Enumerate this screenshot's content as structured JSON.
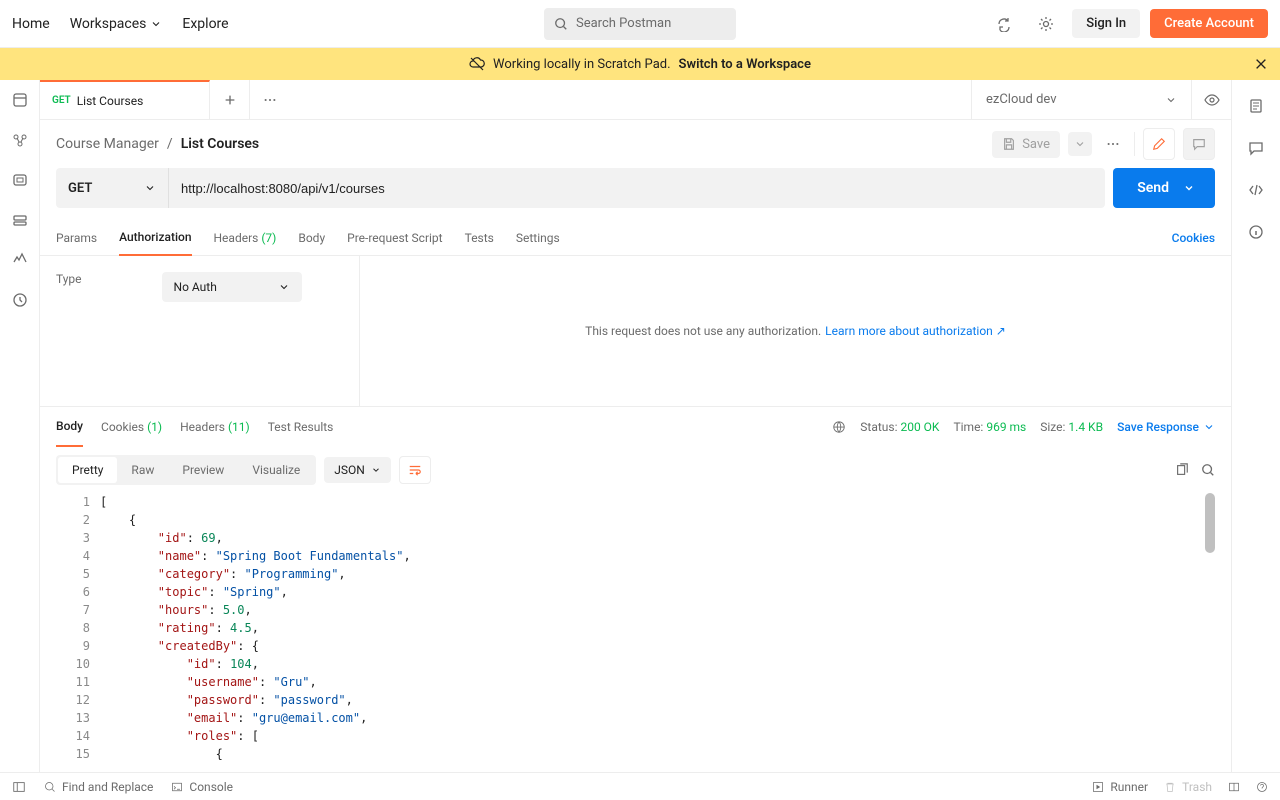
{
  "topnav": {
    "home": "Home",
    "workspaces": "Workspaces",
    "explore": "Explore",
    "search_placeholder": "Search Postman",
    "sign_in": "Sign In",
    "create_account": "Create Account"
  },
  "banner": {
    "text": "Working locally in Scratch Pad.",
    "link": "Switch to a Workspace"
  },
  "tab": {
    "method": "GET",
    "title": "List Courses"
  },
  "environment": "ezCloud dev",
  "breadcrumb": {
    "collection": "Course Manager",
    "request": "List Courses",
    "sep": "/"
  },
  "actions": {
    "save": "Save"
  },
  "request": {
    "method": "GET",
    "url": "http://localhost:8080/api/v1/courses",
    "send": "Send"
  },
  "reqTabs": {
    "params": "Params",
    "auth": "Authorization",
    "headers": "Headers",
    "headers_count": "(7)",
    "body": "Body",
    "prereq": "Pre-request Script",
    "tests": "Tests",
    "settings": "Settings",
    "cookies": "Cookies"
  },
  "auth": {
    "type_label": "Type",
    "type_value": "No Auth",
    "message": "This request does not use any authorization.",
    "link": "Learn more about authorization ↗"
  },
  "respTabs": {
    "body": "Body",
    "cookies": "Cookies",
    "cookies_count": "(1)",
    "headers": "Headers",
    "headers_count": "(11)",
    "test_results": "Test Results"
  },
  "respMeta": {
    "status_label": "Status:",
    "status_value": "200 OK",
    "time_label": "Time:",
    "time_value": "969 ms",
    "size_label": "Size:",
    "size_value": "1.4 KB",
    "save_response": "Save Response"
  },
  "respToolbar": {
    "pretty": "Pretty",
    "raw": "Raw",
    "preview": "Preview",
    "visualize": "Visualize",
    "lang": "JSON"
  },
  "code": {
    "lines": [
      "1",
      "2",
      "3",
      "4",
      "5",
      "6",
      "7",
      "8",
      "9",
      "10",
      "11",
      "12",
      "13",
      "14",
      "15"
    ]
  },
  "json_body": {
    "line1": "[",
    "line2": "    {",
    "line3_k": "\"id\"",
    "line3_n": "69",
    "line4_k": "\"name\"",
    "line4_s": "\"Spring Boot Fundamentals\"",
    "line5_k": "\"category\"",
    "line5_s": "\"Programming\"",
    "line6_k": "\"topic\"",
    "line6_s": "\"Spring\"",
    "line7_k": "\"hours\"",
    "line7_n": "5.0",
    "line8_k": "\"rating\"",
    "line8_n": "4.5",
    "line9_k": "\"createdBy\"",
    "line10_k": "\"id\"",
    "line10_n": "104",
    "line11_k": "\"username\"",
    "line11_s": "\"Gru\"",
    "line12_k": "\"password\"",
    "line12_s": "\"password\"",
    "line13_k": "\"email\"",
    "line13_s": "\"gru@email.com\"",
    "line14_k": "\"roles\"",
    "line15": "                {"
  },
  "footer": {
    "find": "Find and Replace",
    "console": "Console",
    "runner": "Runner",
    "trash": "Trash"
  }
}
